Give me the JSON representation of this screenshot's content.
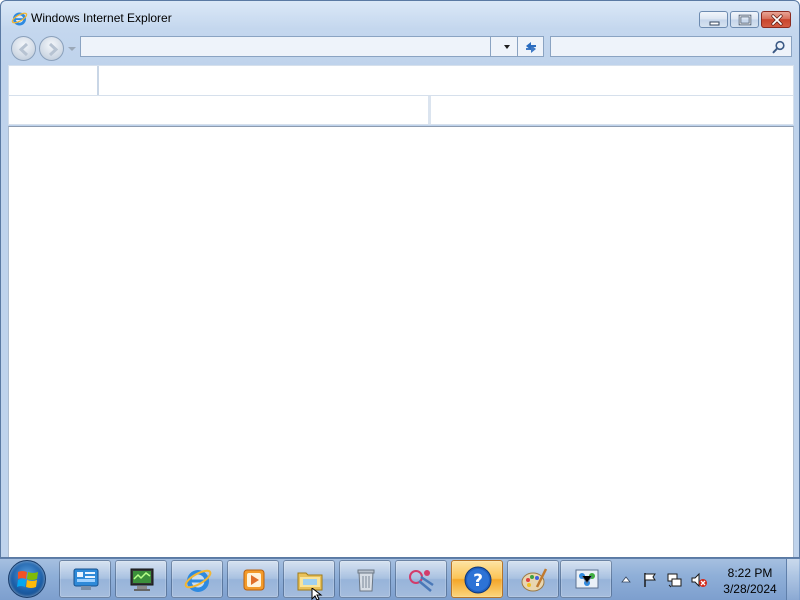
{
  "window": {
    "title": "Windows Internet Explorer"
  },
  "navbar": {
    "address_value": "",
    "search_placeholder": ""
  },
  "icons": {
    "title": "ie-icon",
    "back": "back-arrow-icon",
    "forward": "forward-arrow-icon",
    "address_dropdown": "chevron-down-icon",
    "refresh": "refresh-icon",
    "search": "search-icon",
    "minimize": "minimize-icon",
    "maximize": "maximize-icon",
    "close": "close-icon"
  },
  "taskbar": {
    "buttons": [
      {
        "name": "control-panel",
        "icon": "control-panel-icon"
      },
      {
        "name": "computer-management",
        "icon": "computer-management-icon"
      },
      {
        "name": "internet-explorer",
        "icon": "ie-icon"
      },
      {
        "name": "media-player",
        "icon": "media-player-icon"
      },
      {
        "name": "windows-explorer",
        "icon": "folder-icon"
      },
      {
        "name": "recycle",
        "icon": "recycle-icon"
      },
      {
        "name": "snipping-tool",
        "icon": "scissors-icon"
      },
      {
        "name": "help",
        "icon": "help-icon",
        "active": true
      },
      {
        "name": "paint",
        "icon": "paint-palette-icon"
      },
      {
        "name": "network",
        "icon": "network-icon"
      }
    ]
  },
  "tray": {
    "time": "8:22 PM",
    "date": "3/28/2024"
  },
  "colors": {
    "accent": "#1c5fa8",
    "active_taskbar": "#fbc457",
    "close_button": "#c8442c"
  }
}
